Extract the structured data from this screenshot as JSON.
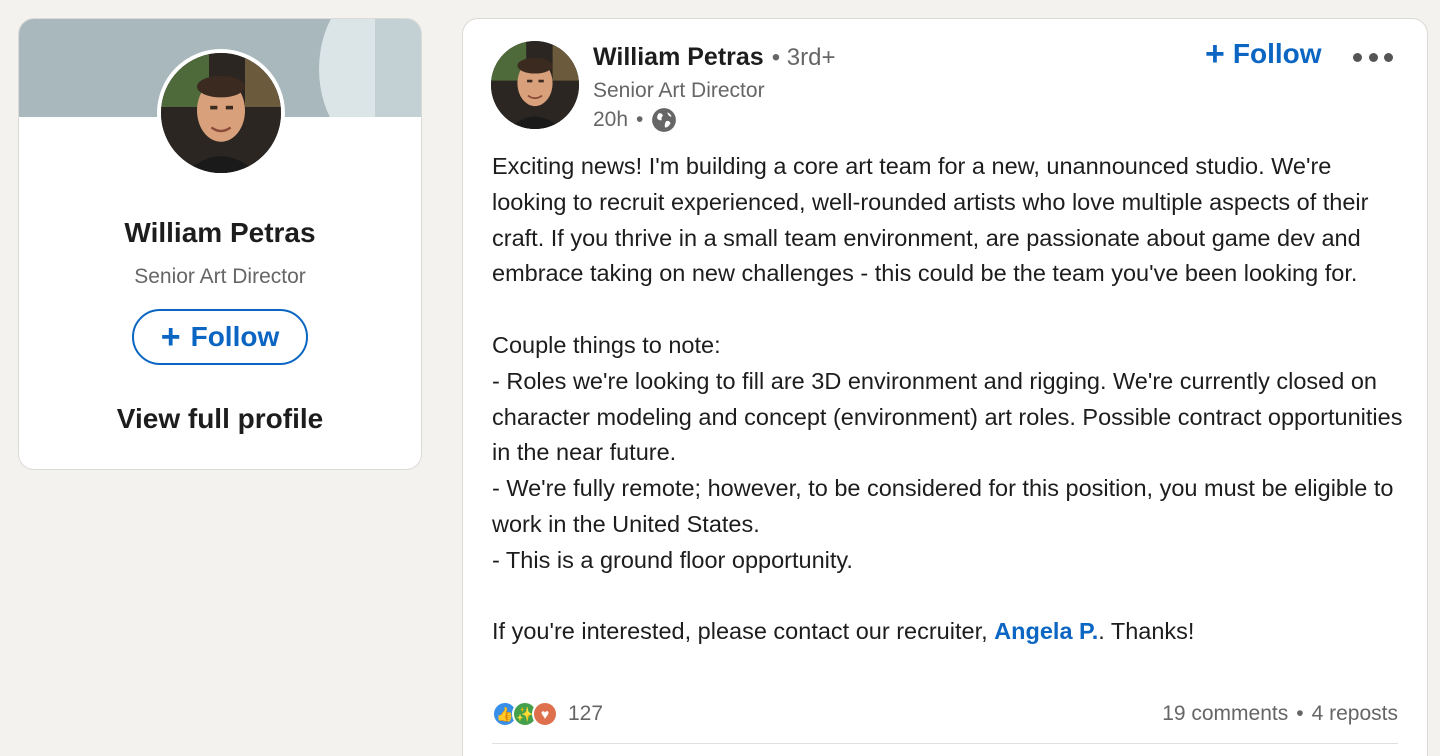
{
  "profile_card": {
    "name": "William Petras",
    "headline": "Senior Art Director",
    "follow_label": "Follow",
    "view_profile_label": "View full profile"
  },
  "post": {
    "author_name": "William Petras",
    "degree": "3rd+",
    "headline": "Senior Art Director",
    "time": "20h",
    "follow_label": "Follow",
    "body_paragraph_1": "Exciting news! I'm building a core art team for a new, unannounced studio. We're looking to recruit experienced, well-rounded artists who love multiple aspects of their craft. If you thrive in a small team environment, are passionate about game dev and embrace taking on new challenges - this could be the team you've been looking for.",
    "body_paragraph_2": "Couple things to note:\n- Roles we're looking to fill are 3D environment and rigging. We're currently closed on character modeling and concept (environment) art roles. Possible contract opportunities in the near future.\n- We're fully remote; however, to be considered for this position, you must be eligible to work in the United States.\n- This is a ground floor opportunity.",
    "body_closing_before": "If you're interested, please contact our recruiter, ",
    "mention": "Angela P.",
    "body_closing_after": ". Thanks!",
    "reaction_count": "127",
    "comments": "19 comments",
    "reposts": "4 reposts"
  },
  "icons": {
    "globe": "globe-icon",
    "more": "more-horizontal-icon",
    "plus": "plus-icon",
    "reactions": [
      "like-icon",
      "celebrate-icon",
      "love-icon"
    ]
  },
  "colors": {
    "accent": "#0a66c2",
    "background": "#f3f2ef",
    "muted_text": "#666666"
  }
}
